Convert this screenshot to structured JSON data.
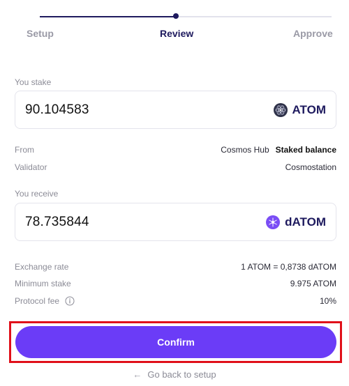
{
  "stepper": {
    "steps": [
      {
        "label": "Setup"
      },
      {
        "label": "Review"
      },
      {
        "label": "Approve"
      }
    ],
    "active_step": "Review"
  },
  "stake": {
    "label": "You stake",
    "amount": "90.104583",
    "token_symbol": "ATOM",
    "token_icon": "atom-icon"
  },
  "details_top": {
    "from_label": "From",
    "from_value": "Cosmos Hub",
    "from_source": "Staked balance",
    "validator_label": "Validator",
    "validator_value": "Cosmostation"
  },
  "receive": {
    "label": "You receive",
    "amount": "78.735844",
    "token_symbol": "dATOM",
    "token_icon": "datom-icon"
  },
  "details_bottom": {
    "exchange_rate_label": "Exchange rate",
    "exchange_rate_value": "1 ATOM = 0,8738 dATOM",
    "minimum_stake_label": "Minimum stake",
    "minimum_stake_value": "9.975 ATOM",
    "protocol_fee_label": "Protocol fee",
    "protocol_fee_value": "10%"
  },
  "actions": {
    "confirm_label": "Confirm",
    "back_label": "Go back to setup"
  },
  "colors": {
    "accent": "#6b3cf7",
    "navy": "#1e1a5e",
    "highlight": "#e0101a"
  }
}
